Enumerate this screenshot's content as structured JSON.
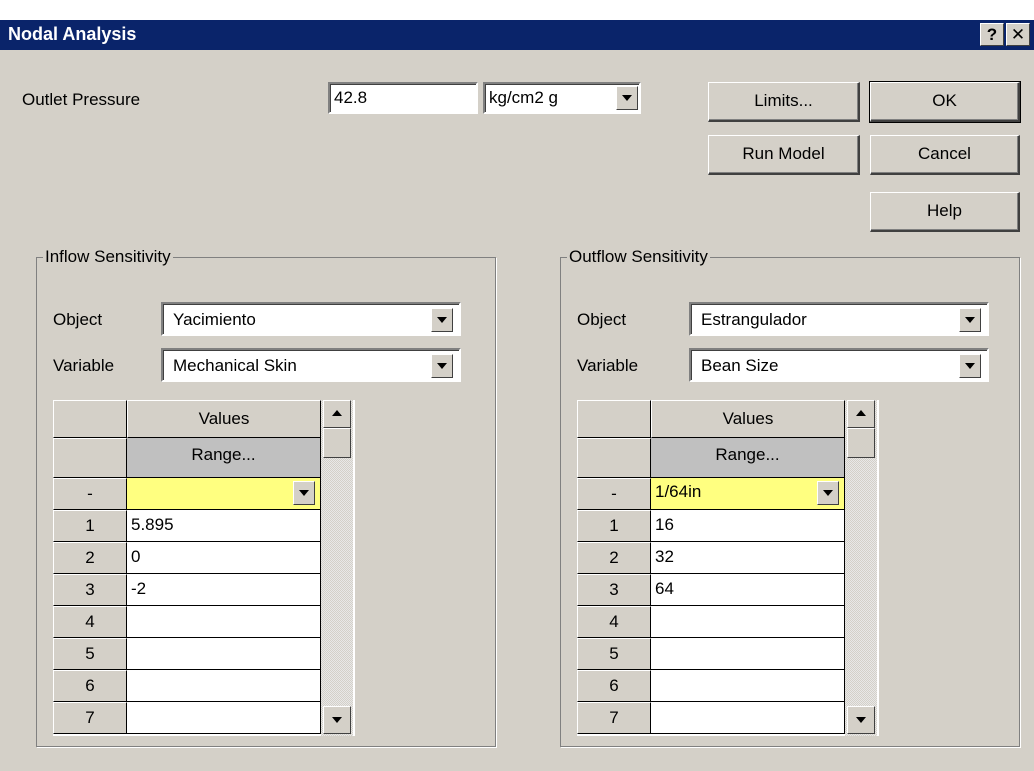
{
  "window": {
    "title": "Nodal Analysis",
    "help_glyph": "?",
    "close_glyph": "✕"
  },
  "outlet": {
    "label": "Outlet Pressure",
    "value": "42.8",
    "unit": "kg/cm2 g"
  },
  "buttons": {
    "limits": "Limits...",
    "ok": "OK",
    "run_model": "Run Model",
    "cancel": "Cancel",
    "help": "Help"
  },
  "inflow": {
    "title": "Inflow Sensitivity",
    "object_label": "Object",
    "object_value": "Yacimiento",
    "variable_label": "Variable",
    "variable_value": "Mechanical Skin",
    "grid": {
      "column_header": "Values",
      "range_label": "Range...",
      "unit_row_label": "-",
      "unit_value": "",
      "rows": [
        {
          "num": "1",
          "value": "5.895"
        },
        {
          "num": "2",
          "value": "0"
        },
        {
          "num": "3",
          "value": "-2"
        },
        {
          "num": "4",
          "value": ""
        },
        {
          "num": "5",
          "value": ""
        },
        {
          "num": "6",
          "value": ""
        },
        {
          "num": "7",
          "value": ""
        }
      ]
    }
  },
  "outflow": {
    "title": "Outflow Sensitivity",
    "object_label": "Object",
    "object_value": "Estrangulador",
    "variable_label": "Variable",
    "variable_value": "Bean Size",
    "grid": {
      "column_header": "Values",
      "range_label": "Range...",
      "unit_row_label": "-",
      "unit_value": "1/64in",
      "rows": [
        {
          "num": "1",
          "value": "16"
        },
        {
          "num": "2",
          "value": "32"
        },
        {
          "num": "3",
          "value": "64"
        },
        {
          "num": "4",
          "value": ""
        },
        {
          "num": "5",
          "value": ""
        },
        {
          "num": "6",
          "value": ""
        },
        {
          "num": "7",
          "value": ""
        }
      ]
    }
  },
  "colors": {
    "titlebar": "#0a246a",
    "face": "#d4d0c8",
    "unit_cell": "#ffff80"
  }
}
